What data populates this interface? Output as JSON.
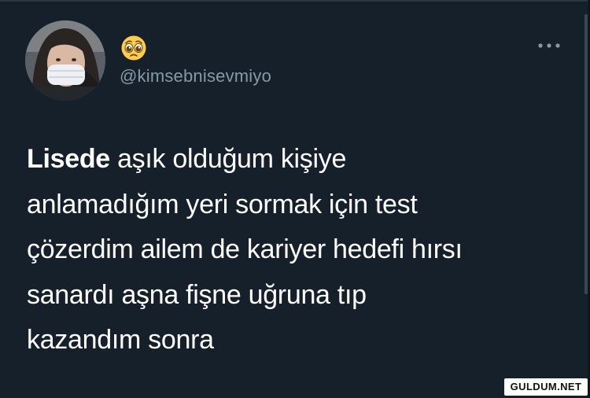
{
  "profile": {
    "display_name_emoji": "pleading-face-emoji",
    "handle": "@kimsebnisevmiyo",
    "avatar": "profile-photo"
  },
  "tweet": {
    "highlight": "Lisede",
    "lines": [
      " aşık olduğum kişiye",
      "anlamadığım yeri sormak için test",
      "çözerdim ailem de kariyer hedefi hırsı",
      "sanardı aşna fişne uğruna tıp",
      "kazandım sonra"
    ]
  },
  "more_icon": "more-horizontal-icon",
  "watermark": "GULDUM.NET",
  "colors": {
    "background": "#15202b",
    "text": "#ffffff",
    "secondary_text": "#8899a6"
  }
}
